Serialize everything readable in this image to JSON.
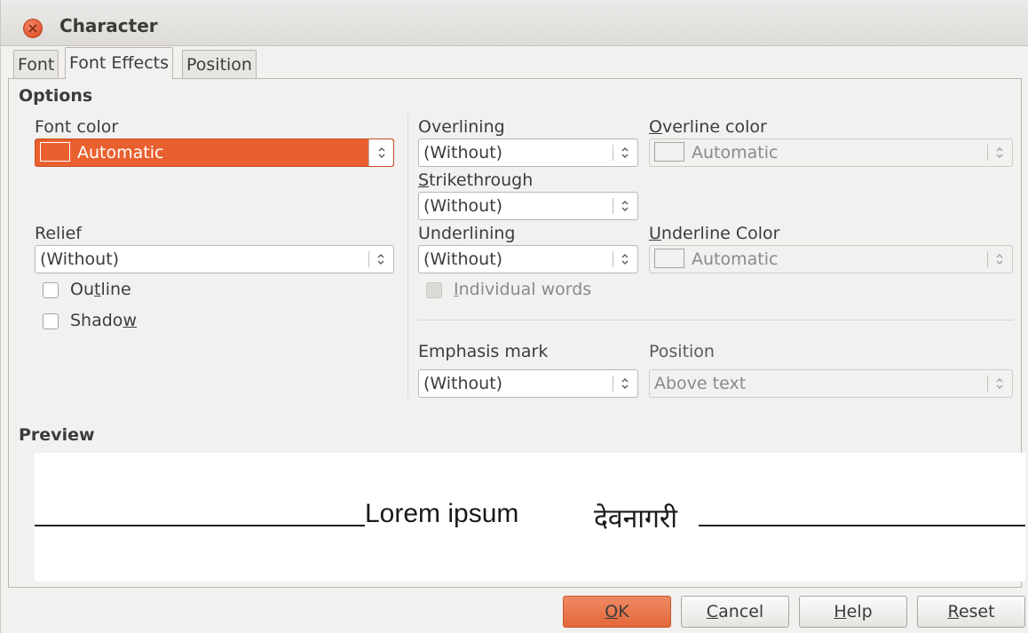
{
  "window": {
    "title": "Character"
  },
  "tabs": [
    {
      "label": "Font"
    },
    {
      "label": "Font Effects"
    },
    {
      "label": "Position"
    }
  ],
  "options": {
    "heading": "Options",
    "font_color": {
      "label": "Font color",
      "value": "Automatic",
      "swatch_color": "#e9602f"
    },
    "relief": {
      "label": "Relief",
      "value": "(Without)"
    },
    "outline": {
      "label_pre": "Ou",
      "label_key": "t",
      "label_post": "line",
      "checked": false
    },
    "shadow": {
      "label_pre": "Shado",
      "label_key": "w",
      "label_post": "",
      "checked": false
    },
    "overlining": {
      "label": "Overlining",
      "value": "(Without)"
    },
    "overline_color": {
      "label_key": "O",
      "label_post": "verline color",
      "value": "Automatic"
    },
    "strikethrough": {
      "label_key": "S",
      "label_post": "trikethrough",
      "value": "(Without)"
    },
    "underlining": {
      "label": "Underlining",
      "value": "(Without)"
    },
    "underline_color": {
      "label_key": "U",
      "label_post": "nderline Color",
      "value": "Automatic"
    },
    "individual_words": {
      "label_key": "I",
      "label_post": "ndividual words",
      "checked": false
    },
    "emphasis_mark": {
      "label": "Emphasis mark",
      "value": "(Without)"
    },
    "position": {
      "label": "Position",
      "value": "Above text"
    }
  },
  "preview": {
    "heading": "Preview",
    "text_latin": "Lorem ipsum",
    "text_devanagari": "देवनागरी"
  },
  "buttons": {
    "ok_key": "O",
    "ok_post": "K",
    "cancel_key": "C",
    "cancel_post": "ancel",
    "help_key": "H",
    "help_post": "elp",
    "reset_key": "R",
    "reset_post": "eset"
  },
  "colors": {
    "accent": "#e9602f",
    "window_bg": "#f2f1f0"
  }
}
